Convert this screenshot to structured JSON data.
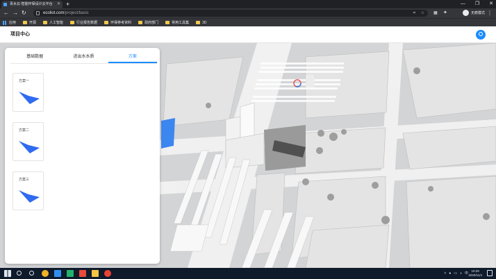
{
  "browser": {
    "tab_title": "青水云-智能环保设计云平台",
    "new_tab": "+",
    "window_controls": [
      "—",
      "❐",
      "✕"
    ],
    "url_host": "ecoliot.com",
    "url_path": "/project/basic",
    "profile_label": "无痕模式",
    "bookmarks": [
      "应用",
      "开源",
      "人工智能",
      "行业报告数据",
      "环保参考资料",
      "政府部门",
      "常用工具集",
      "3D"
    ]
  },
  "app": {
    "title": "项目中心"
  },
  "panel": {
    "tabs": [
      {
        "label": "基础数据",
        "active": false
      },
      {
        "label": "进出水水质",
        "active": false
      },
      {
        "label": "方案",
        "active": true
      }
    ],
    "schemes": [
      {
        "label": "方案一"
      },
      {
        "label": "方案二"
      },
      {
        "label": "方案三"
      }
    ]
  },
  "taskbar": {
    "time": "10:29",
    "date": "2020/11/4",
    "ime": "中"
  },
  "colors": {
    "accent": "#1a8cff",
    "scheme_shape": "#2f6bf0",
    "map_bg": "#cfd0d2"
  }
}
